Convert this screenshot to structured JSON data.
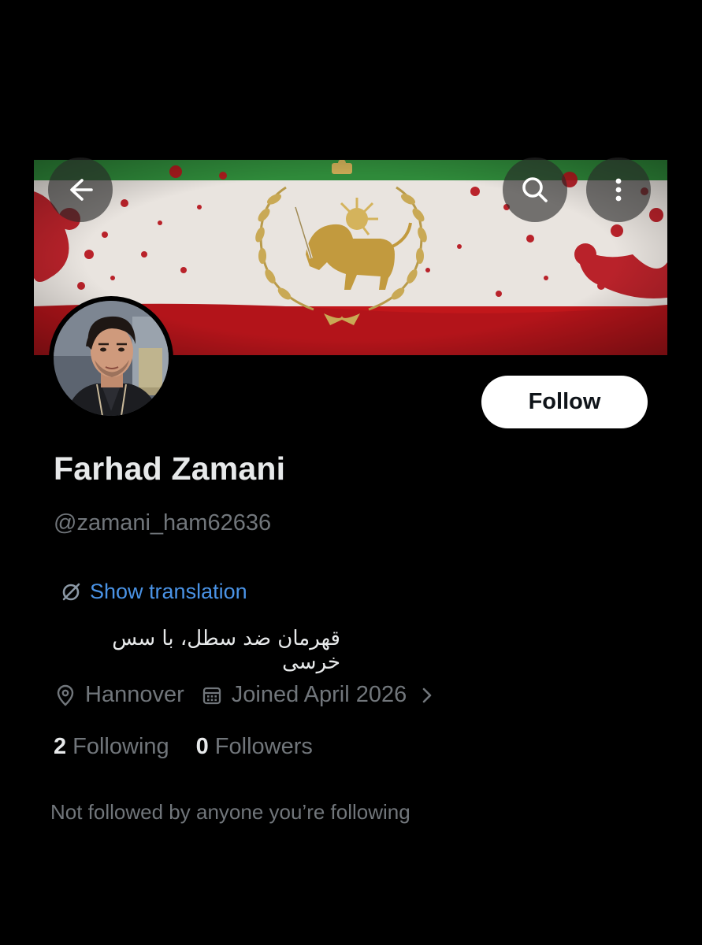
{
  "profile": {
    "display_name": "Farhad Zamani",
    "handle": "@zamani_ham62636",
    "bio": "قهرمان ضد سطل، با سس خرسی",
    "location": "Hannover",
    "joined": "Joined April 2026",
    "following_count": "2",
    "following_label": "Following",
    "followers_count": "0",
    "followers_label": "Followers",
    "not_followed_text": "Not followed by anyone you’re following"
  },
  "actions": {
    "follow_label": "Follow",
    "translate_label": "Show translation"
  },
  "icons": {
    "back": "back-arrow-icon",
    "search": "search-icon",
    "more": "more-vertical-icon",
    "translate": "translate-icon",
    "location": "location-pin-icon",
    "calendar": "calendar-icon",
    "chevron": "chevron-right-icon"
  },
  "colors": {
    "background": "#000000",
    "text_primary": "#e7e9ea",
    "text_secondary": "#71767b",
    "link": "#4a93e6",
    "flag_green": "#2f8a3a",
    "flag_white": "#e9e4df",
    "flag_red": "#c2171b"
  }
}
